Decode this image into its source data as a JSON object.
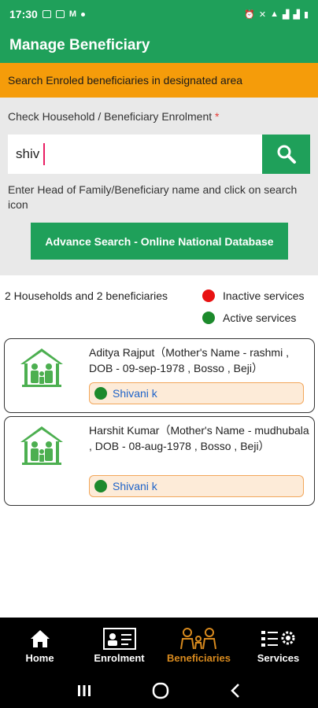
{
  "status_bar": {
    "time": "17:30"
  },
  "app_bar": {
    "title": "Manage Beneficiary"
  },
  "notice": {
    "text": "Search Enroled beneficiaries in designated area"
  },
  "search": {
    "label": "Check Household / Beneficiary Enrolment",
    "required_mark": "*",
    "value": "shiv",
    "hint": "Enter Head of Family/Beneficiary name and click on search icon",
    "advance_button": "Advance Search - Online National Database"
  },
  "results": {
    "summary": "2 Households and 2 beneficiaries",
    "legend": [
      {
        "label": "Inactive services",
        "color": "#e81212"
      },
      {
        "label": "Active services",
        "color": "#1c8a2c"
      }
    ],
    "cards": [
      {
        "details": "Aditya Rajput（Mother's Name - rashmi , DOB - 09-sep-1978 , Bosso , Beji）",
        "beneficiary": "Shivani k",
        "status_color": "#1c8a2c"
      },
      {
        "details": "Harshit Kumar（Mother's Name - mudhubala , DOB - 08-aug-1978 , Bosso , Beji）",
        "beneficiary": "Shivani k",
        "status_color": "#1c8a2c"
      }
    ]
  },
  "bottom_nav": {
    "items": [
      {
        "label": "Home",
        "icon": "home-icon"
      },
      {
        "label": "Enrolment",
        "icon": "enrolment-icon"
      },
      {
        "label": "Beneficiaries",
        "icon": "beneficiaries-icon",
        "active": true
      },
      {
        "label": "Services",
        "icon": "services-icon"
      }
    ]
  },
  "colors": {
    "primary": "#1fa05a",
    "notice": "#f59c0a",
    "active_nav": "#d88a1e"
  }
}
